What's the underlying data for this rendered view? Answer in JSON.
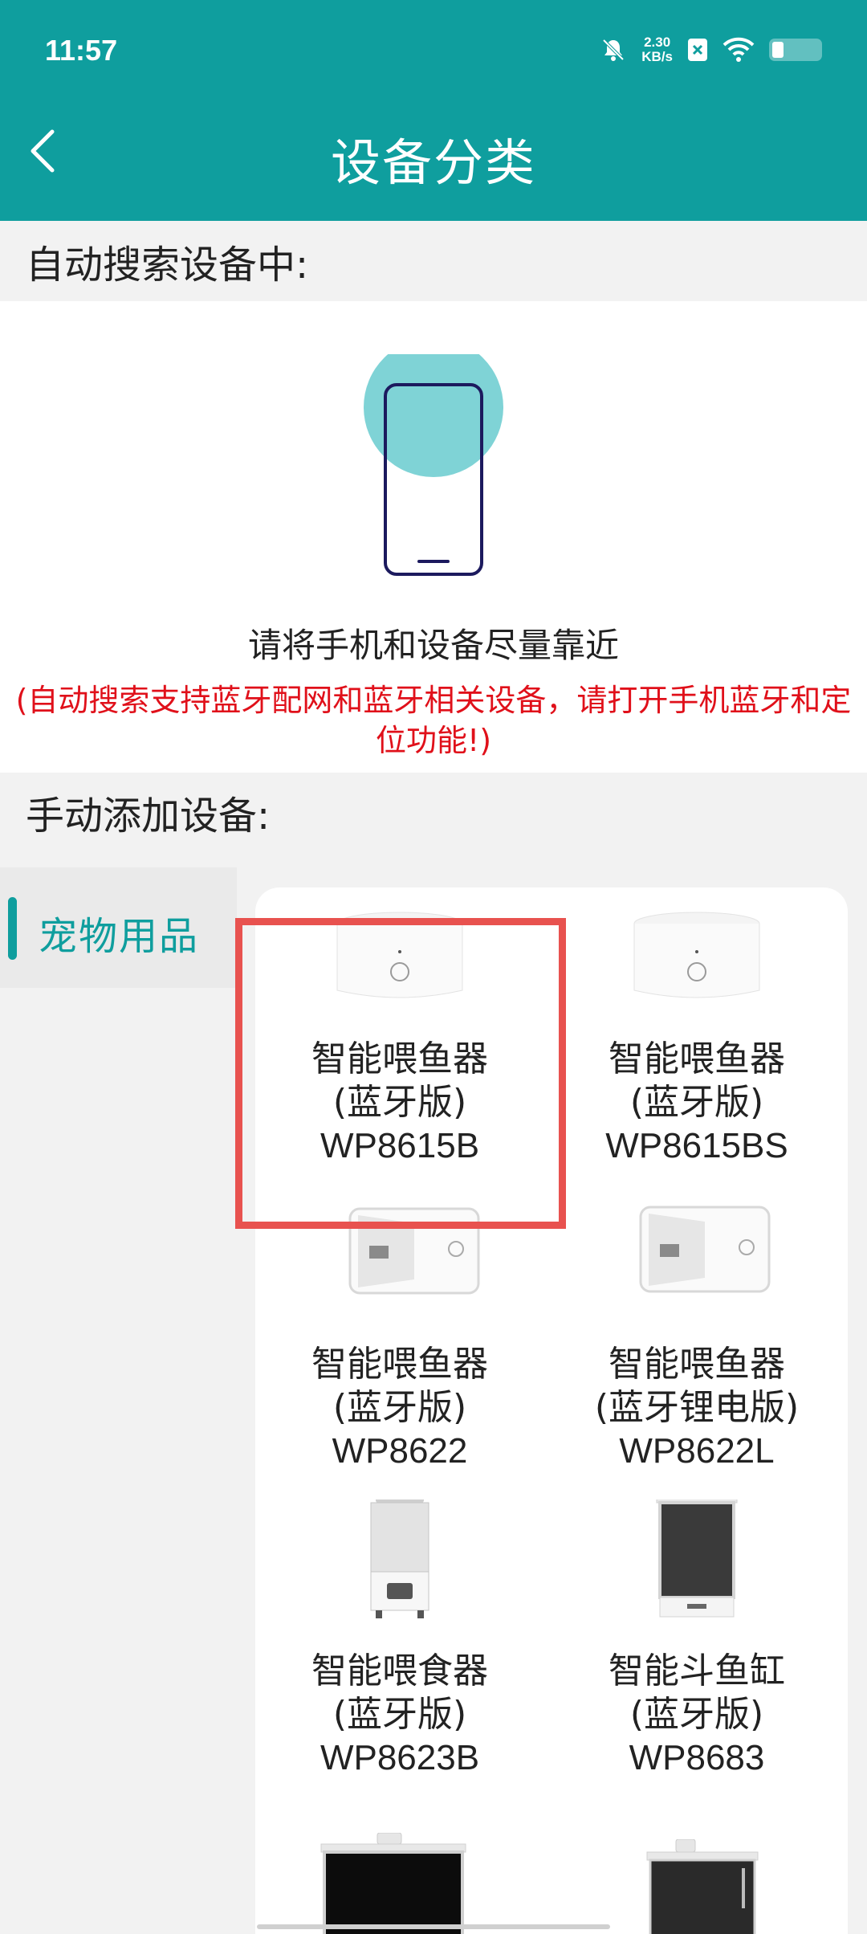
{
  "status_bar": {
    "time": "11:57",
    "net_speed_value": "2.30",
    "net_speed_unit": "KB/s"
  },
  "header": {
    "title": "设备分类",
    "back_icon": "chevron-left-icon",
    "bg_color": "#0f9e9e"
  },
  "auto_search": {
    "heading": "自动搜索设备中:",
    "hint": "请将手机和设备尽量靠近",
    "warning": "(自动搜索支持蓝牙配网和蓝牙相关设备，请打开手机蓝牙和定位功能!)"
  },
  "manual_add": {
    "heading": "手动添加设备:"
  },
  "category": {
    "selected_label": "宠物用品"
  },
  "devices": [
    {
      "name": "智能喂鱼器",
      "variant": "(蓝牙版)",
      "model": "WP8615B"
    },
    {
      "name": "智能喂鱼器",
      "variant": "(蓝牙版)",
      "model": "WP8615BS"
    },
    {
      "name": "智能喂鱼器",
      "variant": "(蓝牙版)",
      "model": "WP8622"
    },
    {
      "name": "智能喂鱼器",
      "variant": "(蓝牙锂电版)",
      "model": "WP8622L"
    },
    {
      "name": "智能喂食器",
      "variant": "(蓝牙版)",
      "model": "WP8623B"
    },
    {
      "name": "智能斗鱼缸",
      "variant": "(蓝牙版)",
      "model": "WP8683"
    }
  ],
  "colors": {
    "accent": "#0f9e9e",
    "warning": "#e0101a",
    "highlight": "#e8524f"
  }
}
